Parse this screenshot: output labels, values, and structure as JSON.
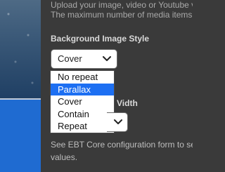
{
  "description": {
    "line1": "Upload your image, video or Youtube v",
    "line2": "The maximum number of media items"
  },
  "background_style": {
    "label": "Background Image Style",
    "selected": "Cover",
    "options": [
      "No repeat",
      "Parallax",
      "Cover",
      "Contain",
      "Repeat"
    ],
    "highlighted_option": "Parallax"
  },
  "second_field": {
    "label_fragment": "Vidth"
  },
  "note": {
    "line1": "See EBT Core configuration form to se",
    "line2": "values."
  },
  "colors": {
    "page_bg": "#3a3a3a",
    "left_blue": "#1f6bd1",
    "highlight": "#1d6ff2"
  },
  "icons": {
    "select_arrow": "chevron-down-icon"
  }
}
